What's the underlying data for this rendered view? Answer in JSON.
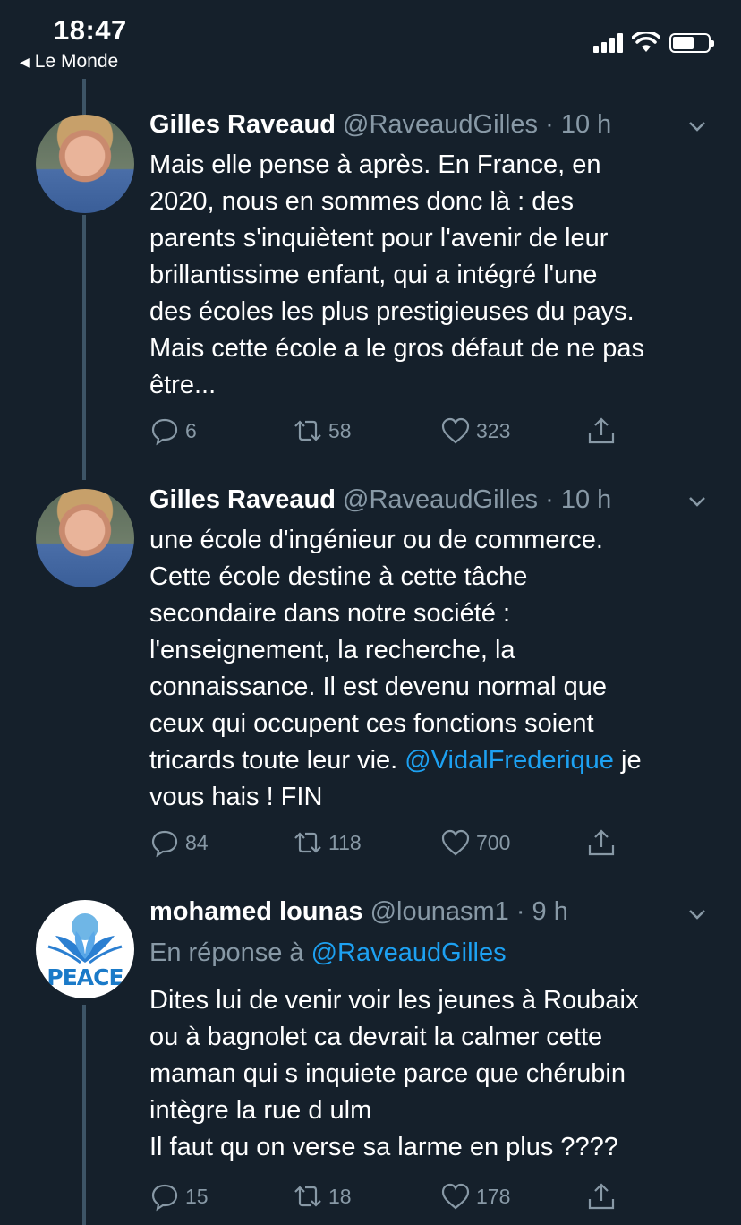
{
  "status_bar": {
    "time": "18:47",
    "back_label": "Le Monde",
    "battery_level": 0.6
  },
  "tweets": [
    {
      "name": "Gilles Raveaud",
      "handle": "@RaveaudGilles",
      "dot": "·",
      "time_ago": "10 h",
      "avatar_icon": "avatar-person",
      "lines": [
        "Mais elle pense à après. En France, en",
        "2020, nous en sommes donc là : des",
        "parents s'inquiètent pour l'avenir de leur",
        "brillantissime enfant, qui a intégré l'une",
        "des écoles les plus prestigieuses du pays.",
        "Mais cette école a le gros défaut de ne pas",
        "être..."
      ],
      "replies": "6",
      "retweets": "58",
      "likes": "323"
    },
    {
      "name": "Gilles Raveaud",
      "handle": "@RaveaudGilles",
      "dot": "·",
      "time_ago": "10 h",
      "avatar_icon": "avatar-person",
      "lines": [
        "une école d'ingénieur ou de commerce.",
        "Cette école destine à cette tâche",
        "secondaire dans notre société :",
        "l'enseignement, la recherche, la",
        "connaissance. Il est devenu normal que",
        "ceux qui occupent ces fonctions soient"
      ],
      "line_7_before": "tricards toute leur vie. ",
      "line_7_mention": "@VidalFrederique",
      "line_7_after": " je",
      "line_8": "vous hais ! FIN",
      "replies": "84",
      "retweets": "118",
      "likes": "700"
    },
    {
      "name": "mohamed lounas",
      "handle": "@lounasm1",
      "dot": "·",
      "time_ago": "9 h",
      "avatar_icon": "avatar-peace",
      "avatar_text": "PEACE",
      "reply_prefix": "En réponse à ",
      "reply_mention": "@RaveaudGilles",
      "lines": [
        "Dites lui de venir voir les jeunes à Roubaix",
        "ou à bagnolet ca devrait la calmer cette",
        "maman qui s inquiete parce que chérubin",
        "intègre la rue d ulm",
        "Il faut qu on verse sa larme en plus ????"
      ],
      "replies": "15",
      "retweets": "18",
      "likes": "178"
    }
  ],
  "colors": {
    "background": "#15202b",
    "secondary_text": "#8899a6",
    "link": "#1da1f2",
    "divider": "#38444d",
    "thread_line": "#3d5466"
  }
}
